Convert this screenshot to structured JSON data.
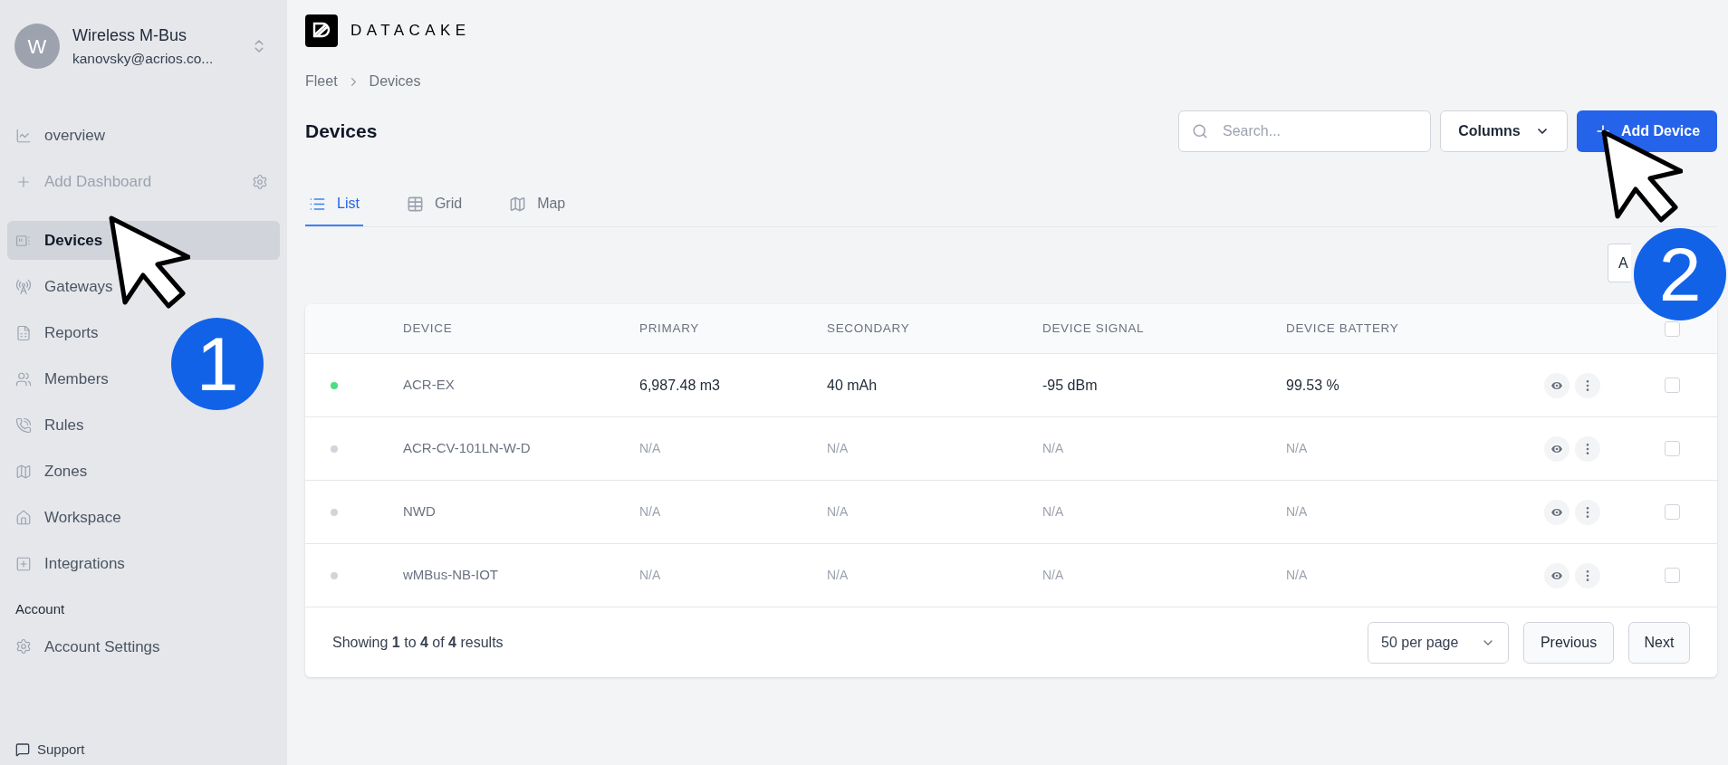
{
  "sidebar": {
    "workspace": {
      "avatar": "W",
      "name": "Wireless M-Bus",
      "email": "kanovsky@acrios.co..."
    },
    "items": [
      {
        "label": "overview",
        "selected": false,
        "disabled": false
      },
      {
        "label": "Add Dashboard",
        "selected": false,
        "disabled": true
      },
      {
        "label": "Devices",
        "selected": true,
        "disabled": false
      },
      {
        "label": "Gateways",
        "selected": false,
        "disabled": false
      },
      {
        "label": "Reports",
        "selected": false,
        "disabled": false
      },
      {
        "label": "Members",
        "selected": false,
        "disabled": false
      },
      {
        "label": "Rules",
        "selected": false,
        "disabled": false
      },
      {
        "label": "Zones",
        "selected": false,
        "disabled": false
      },
      {
        "label": "Workspace",
        "selected": false,
        "disabled": false
      },
      {
        "label": "Integrations",
        "selected": false,
        "disabled": false
      }
    ],
    "account_heading": "Account",
    "account_items": [
      {
        "label": "Account Settings",
        "selected": false
      }
    ],
    "support": "Support"
  },
  "logo": "DATACAKE",
  "breadcrumb": [
    "Fleet",
    "Devices"
  ],
  "page_title": "Devices",
  "search": {
    "placeholder": "Search..."
  },
  "columns_button": "Columns",
  "add_button": "Add Device",
  "tabs": [
    {
      "label": "List",
      "selected": true
    },
    {
      "label": "Grid",
      "selected": false
    },
    {
      "label": "Map",
      "selected": false
    }
  ],
  "partial_button": "A",
  "table": {
    "columns": [
      "DEVICE",
      "PRIMARY",
      "SECONDARY",
      "DEVICE SIGNAL",
      "DEVICE BATTERY"
    ],
    "header_checked": false,
    "rows": [
      {
        "online": true,
        "device": "ACR-EX",
        "primary": "6,987.48 m3",
        "secondary": "40 mAh",
        "signal": "-95 dBm",
        "battery": "99.53 %",
        "checked": false
      },
      {
        "online": false,
        "device": "ACR-CV-101LN-W-D",
        "primary": "N/A",
        "secondary": "N/A",
        "signal": "N/A",
        "battery": "N/A",
        "checked": false
      },
      {
        "online": false,
        "device": "NWD",
        "primary": "N/A",
        "secondary": "N/A",
        "signal": "N/A",
        "battery": "N/A",
        "checked": false
      },
      {
        "online": false,
        "device": "wMBus-NB-IOT",
        "primary": "N/A",
        "secondary": "N/A",
        "signal": "N/A",
        "battery": "N/A",
        "checked": false
      }
    ]
  },
  "footer": {
    "summary": "Showing **1** to **4** of **4** results",
    "per_page": "50 per page",
    "previous": "Previous",
    "next": "Next"
  },
  "callouts": [
    {
      "label": "1"
    },
    {
      "label": "2"
    }
  ]
}
